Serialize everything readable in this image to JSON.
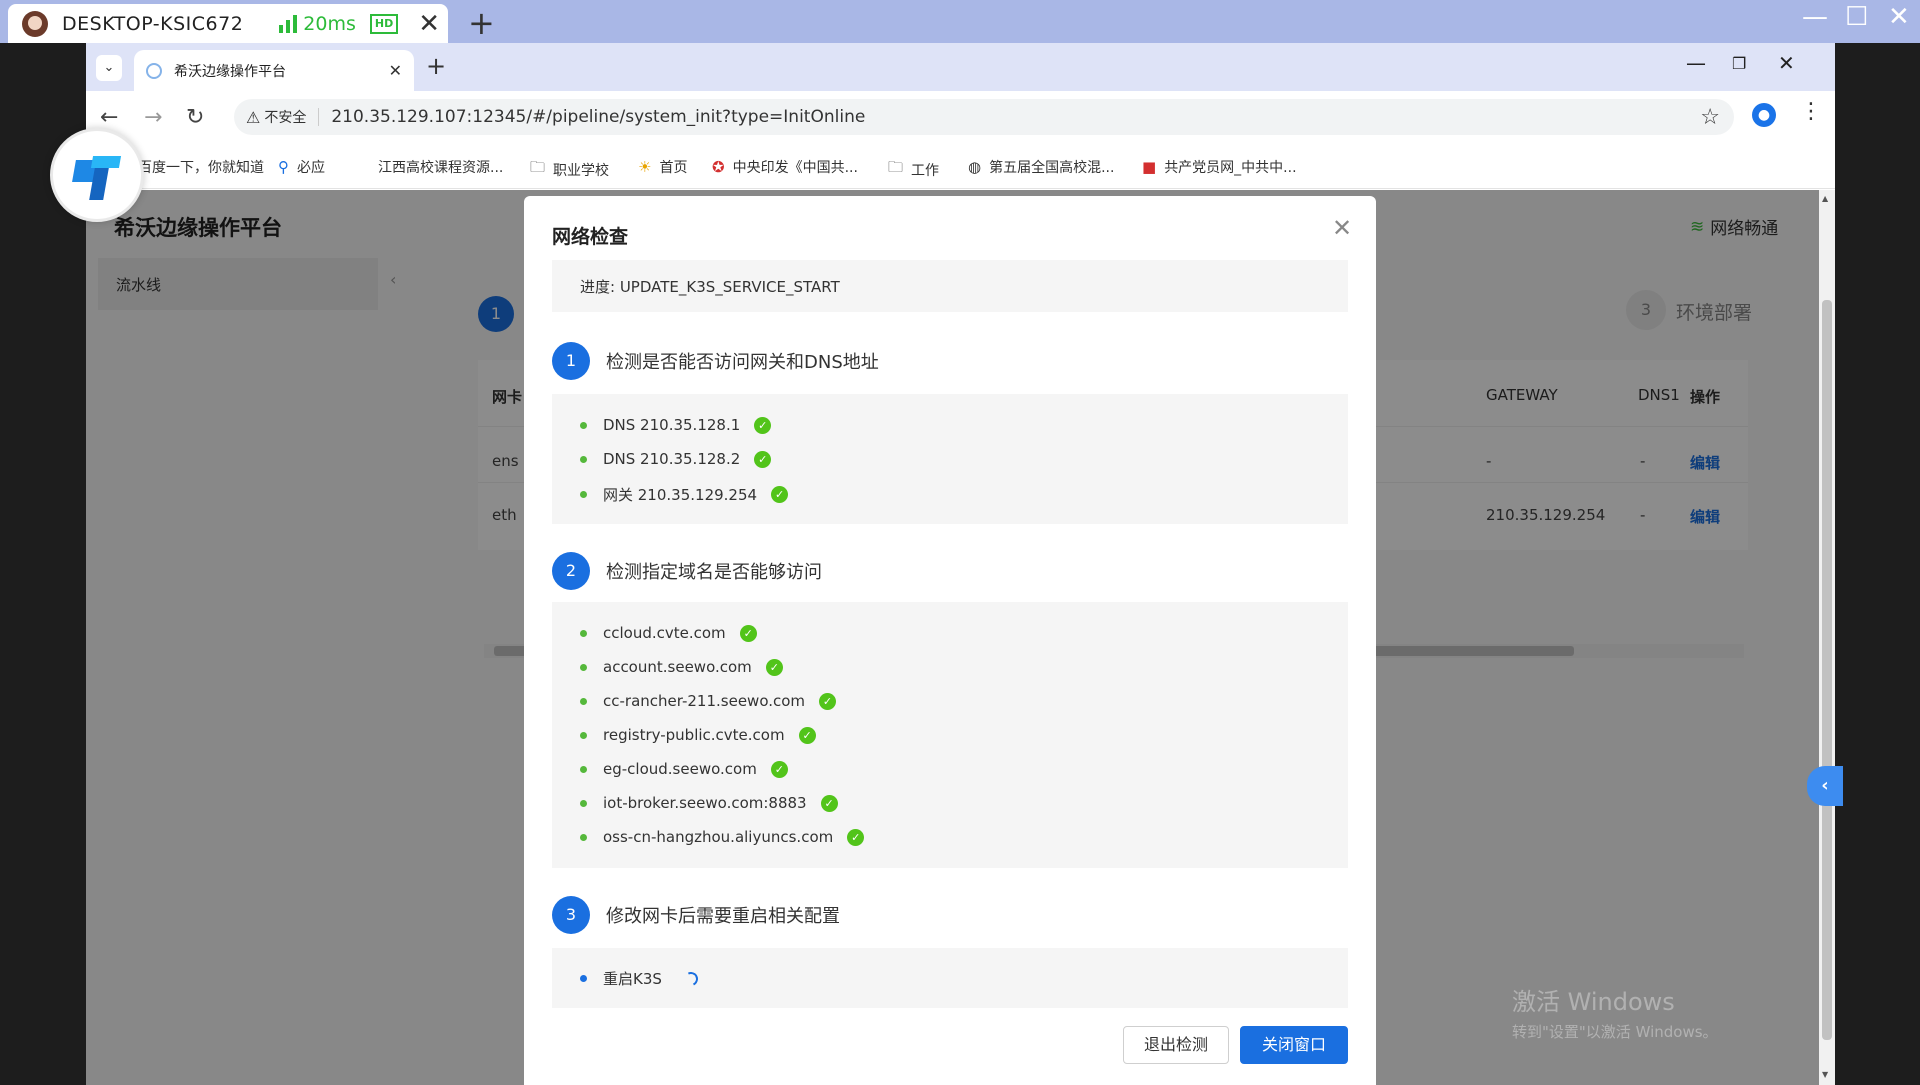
{
  "remote_desktop": {
    "host": "DESKTOP-KSIC672",
    "latency": "20ms",
    "quality_badge": "HD"
  },
  "browser": {
    "tab_title": "希沃边缘操作平台",
    "security_label": "不安全",
    "url": "210.35.129.107:12345/#/pipeline/system_init?type=InitOnline",
    "bookmarks": [
      "百度一下，你就知道",
      "必应",
      "江西高校课程资源...",
      "职业学校",
      "首页",
      "中央印发《中国共...",
      "工作",
      "第五届全国高校混...",
      "共产党员网_中共中..."
    ]
  },
  "page": {
    "title": "希沃边缘操作平台",
    "network_status": "网络畅通",
    "sidebar_item": "流水线",
    "step1_num": "1",
    "step3_num": "3",
    "step3_label": "环境部署",
    "table": {
      "col_nic": "网卡",
      "col_gateway": "GATEWAY",
      "col_dns1": "DNS1",
      "col_action": "操作",
      "rows": [
        {
          "nic": "ens",
          "gateway": "-",
          "dns1": "-",
          "action": "编辑"
        },
        {
          "nic": "eth",
          "gateway": "210.35.129.254",
          "dns1": "-",
          "action": "编辑"
        }
      ]
    }
  },
  "modal": {
    "title": "网络检查",
    "progress": "进度: UPDATE_K3S_SERVICE_START",
    "sections": [
      {
        "num": "1",
        "title": "检测是否能否访问网关和DNS地址",
        "items": [
          "DNS 210.35.128.1",
          "DNS 210.35.128.2",
          "网关 210.35.129.254"
        ]
      },
      {
        "num": "2",
        "title": "检测指定域名是否能够访问",
        "items": [
          "ccloud.cvte.com",
          "account.seewo.com",
          "cc-rancher-211.seewo.com",
          "registry-public.cvte.com",
          "eg-cloud.seewo.com",
          "iot-broker.seewo.com:8883",
          "oss-cn-hangzhou.aliyuncs.com"
        ]
      },
      {
        "num": "3",
        "title": "修改网卡后需要重启相关配置",
        "items": [
          "重启K3S"
        ]
      }
    ],
    "btn_exit": "退出检测",
    "btn_close": "关闭窗口"
  },
  "watermark": {
    "line1": "激活 Windows",
    "line2": "转到\"设置\"以激活 Windows。"
  },
  "colors": {
    "primary": "#1a6fe0",
    "success": "#52c41a",
    "remote_bar": "#a9b7e6"
  }
}
